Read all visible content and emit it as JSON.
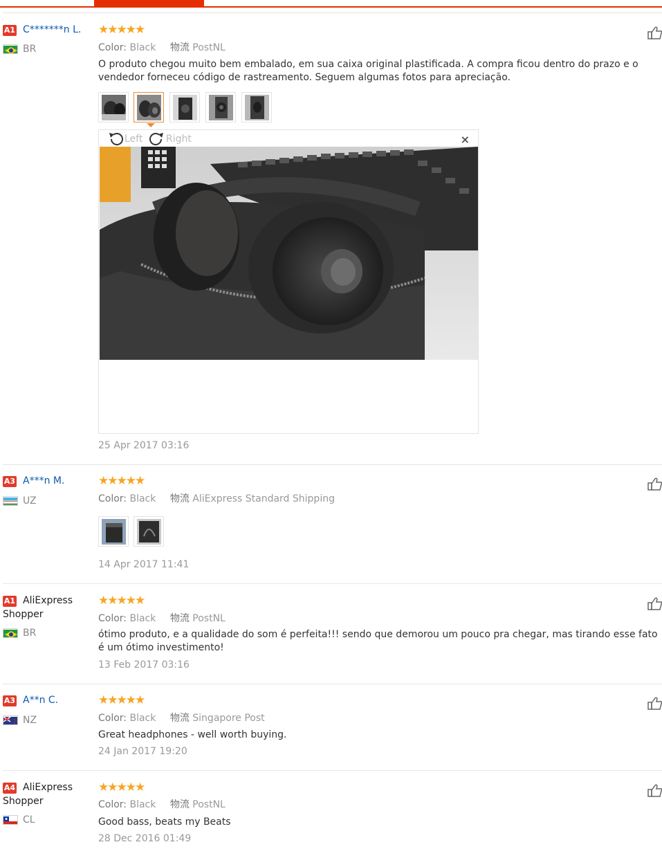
{
  "labels": {
    "color": "Color:",
    "shipping": "物流",
    "rotate_left": "Left",
    "rotate_right": "Right"
  },
  "colors": {
    "accent": "#e62e04",
    "star": "#f6a623",
    "link": "#0b5ab0",
    "badge": "#e13b2b"
  },
  "reviews": [
    {
      "level": "A1",
      "name": "C*******n L.",
      "country": "BR",
      "flag": "brazil-flag",
      "stars": "★★★★★",
      "rating": 5,
      "color": "Black",
      "shipping": "PostNL",
      "text": "O produto chegou muito bem embalado, em sua caixa original plastificada. A compra ficou dentro do prazo e o vendedor forneceu código de rastreamento. Seguem algumas fotos para apreciação.",
      "date": "25 Apr 2017 03:16",
      "photos": 5
    },
    {
      "level": "A3",
      "name": "A***n M.",
      "country": "UZ",
      "flag": "uzbekistan-flag",
      "stars": "★★★★★",
      "rating": 5,
      "color": "Black",
      "shipping": "AliExpress Standard Shipping",
      "text": "",
      "date": "14 Apr 2017 11:41",
      "photos": 2
    },
    {
      "level": "A1",
      "name": "AliExpress Shopper",
      "country": "BR",
      "flag": "brazil-flag",
      "stars": "★★★★★",
      "rating": 5,
      "color": "Black",
      "shipping": "PostNL",
      "text": "ótimo produto, e a qualidade do som é perfeita!!! sendo que demorou um pouco pra chegar, mas tirando esse fato é um ótimo investimento!",
      "date": "13 Feb 2017 03:16",
      "photos": 0
    },
    {
      "level": "A3",
      "name": "A**n C.",
      "country": "NZ",
      "flag": "new-zealand-flag",
      "stars": "★★★★★",
      "rating": 5,
      "color": "Black",
      "shipping": "Singapore Post",
      "text": "Great headphones - well worth buying.",
      "date": "24 Jan 2017 19:20",
      "photos": 0
    },
    {
      "level": "A4",
      "name": "AliExpress Shopper",
      "country": "CL",
      "flag": "chile-flag",
      "stars": "★★★★★",
      "rating": 5,
      "color": "Black",
      "shipping": "PostNL",
      "text": "Good bass, beats my Beats",
      "date": "28 Dec 2016 01:49",
      "photos": 0
    }
  ]
}
